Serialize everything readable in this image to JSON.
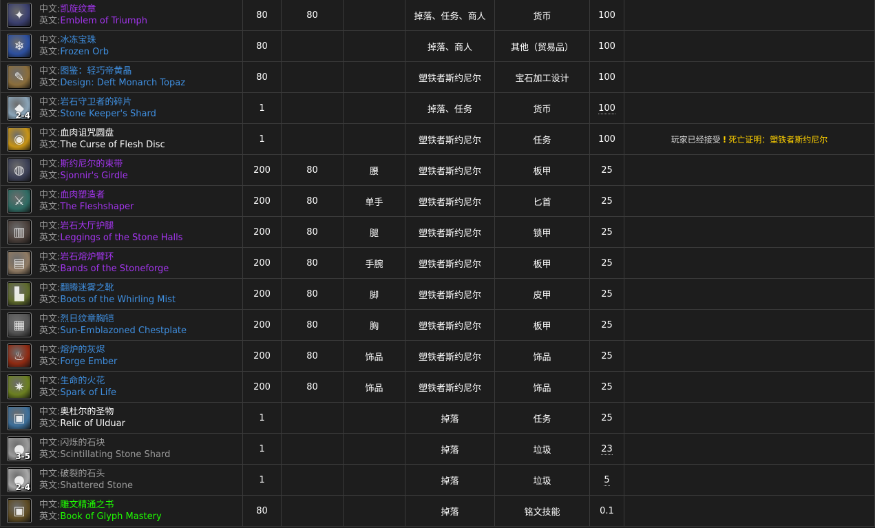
{
  "labels": {
    "zh": "中文:",
    "en": "英文:"
  },
  "rows": [
    {
      "icon": "emblem-of-triumph-icon",
      "bg": "#3a3f6e",
      "glyph": "✦",
      "zh": "凯旋纹章",
      "en": "Emblem of Triumph",
      "quality": "epic",
      "item_level": "80",
      "req_level": "80",
      "slot": "",
      "source": "掉落、任务、商人",
      "type": "货币",
      "pct": "100",
      "pct_dotted": false,
      "note_prefix": "",
      "note_quest": "",
      "stack": ""
    },
    {
      "icon": "frozen-orb-icon",
      "bg": "#2c4f9e",
      "glyph": "❄",
      "zh": "冰冻宝珠",
      "en": "Frozen Orb",
      "quality": "rare",
      "item_level": "80",
      "req_level": "",
      "slot": "",
      "source": "掉落、商人",
      "type": "其他（贸易品）",
      "pct": "100",
      "pct_dotted": false,
      "note_prefix": "",
      "note_quest": "",
      "stack": ""
    },
    {
      "icon": "design-scroll-icon",
      "bg": "#8a6d3b",
      "glyph": "✎",
      "zh": "图鉴：轻巧帝黄晶",
      "en": "Design: Deft Monarch Topaz",
      "quality": "rare",
      "item_level": "80",
      "req_level": "",
      "slot": "",
      "source": "塑铁者斯约尼尔",
      "type": "宝石加工设计",
      "pct": "100",
      "pct_dotted": false,
      "note_prefix": "",
      "note_quest": "",
      "stack": ""
    },
    {
      "icon": "stone-shard-icon",
      "bg": "#8aa4b8",
      "glyph": "◆",
      "zh": "岩石守卫者的碎片",
      "en": "Stone Keeper's Shard",
      "quality": "rare",
      "item_level": "1",
      "req_level": "",
      "slot": "",
      "source": "掉落、任务",
      "type": "货币",
      "pct": "100",
      "pct_dotted": true,
      "note_prefix": "",
      "note_quest": "",
      "stack": "2-4"
    },
    {
      "icon": "flesh-disc-icon",
      "bg": "#c79416",
      "glyph": "◉",
      "zh": "血肉诅咒圆盘",
      "en": "The Curse of Flesh Disc",
      "quality": "common",
      "item_level": "1",
      "req_level": "",
      "slot": "",
      "source": "塑铁者斯约尼尔",
      "type": "任务",
      "pct": "100",
      "pct_dotted": false,
      "note_prefix": "玩家已经接受",
      "note_quest": "死亡证明：塑铁者斯约尼尔",
      "stack": ""
    },
    {
      "icon": "girdle-icon",
      "bg": "#3b3f55",
      "glyph": "◍",
      "zh": "斯约尼尔的束带",
      "en": "Sjonnir's Girdle",
      "quality": "epic",
      "item_level": "200",
      "req_level": "80",
      "slot": "腰",
      "source": "塑铁者斯约尼尔",
      "type": "板甲",
      "pct": "25",
      "pct_dotted": false,
      "note_prefix": "",
      "note_quest": "",
      "stack": ""
    },
    {
      "icon": "dagger-icon",
      "bg": "#2f6b63",
      "glyph": "⚔",
      "zh": "血肉塑造者",
      "en": "The Fleshshaper",
      "quality": "epic",
      "item_level": "200",
      "req_level": "80",
      "slot": "单手",
      "source": "塑铁者斯约尼尔",
      "type": "匕首",
      "pct": "25",
      "pct_dotted": false,
      "note_prefix": "",
      "note_quest": "",
      "stack": ""
    },
    {
      "icon": "leggings-icon",
      "bg": "#4a3f3a",
      "glyph": "▥",
      "zh": "岩石大厅护腿",
      "en": "Leggings of the Stone Halls",
      "quality": "epic",
      "item_level": "200",
      "req_level": "80",
      "slot": "腿",
      "source": "塑铁者斯约尼尔",
      "type": "锁甲",
      "pct": "25",
      "pct_dotted": false,
      "note_prefix": "",
      "note_quest": "",
      "stack": ""
    },
    {
      "icon": "bracer-icon",
      "bg": "#8f7a63",
      "glyph": "▤",
      "zh": "岩石熔炉臂环",
      "en": "Bands of the Stoneforge",
      "quality": "epic",
      "item_level": "200",
      "req_level": "80",
      "slot": "手腕",
      "source": "塑铁者斯约尼尔",
      "type": "板甲",
      "pct": "25",
      "pct_dotted": false,
      "note_prefix": "",
      "note_quest": "",
      "stack": ""
    },
    {
      "icon": "boots-icon",
      "bg": "#5e6a2c",
      "glyph": "▙",
      "zh": "翻腾迷雾之靴",
      "en": "Boots of the Whirling Mist",
      "quality": "rare",
      "item_level": "200",
      "req_level": "80",
      "slot": "脚",
      "source": "塑铁者斯约尼尔",
      "type": "皮甲",
      "pct": "25",
      "pct_dotted": false,
      "note_prefix": "",
      "note_quest": "",
      "stack": ""
    },
    {
      "icon": "chestplate-icon",
      "bg": "#555555",
      "glyph": "▦",
      "zh": "烈日纹章胸铠",
      "en": "Sun-Emblazoned Chestplate",
      "quality": "rare",
      "item_level": "200",
      "req_level": "80",
      "slot": "胸",
      "source": "塑铁者斯约尼尔",
      "type": "板甲",
      "pct": "25",
      "pct_dotted": false,
      "note_prefix": "",
      "note_quest": "",
      "stack": ""
    },
    {
      "icon": "ember-icon",
      "bg": "#8e2a12",
      "glyph": "♨",
      "zh": "熔炉的灰烬",
      "en": "Forge Ember",
      "quality": "rare",
      "item_level": "200",
      "req_level": "80",
      "slot": "饰品",
      "source": "塑铁者斯约尼尔",
      "type": "饰品",
      "pct": "25",
      "pct_dotted": false,
      "note_prefix": "",
      "note_quest": "",
      "stack": ""
    },
    {
      "icon": "spark-icon",
      "bg": "#6b7f20",
      "glyph": "✷",
      "zh": "生命的火花",
      "en": "Spark of Life",
      "quality": "rare",
      "item_level": "200",
      "req_level": "80",
      "slot": "饰品",
      "source": "塑铁者斯约尼尔",
      "type": "饰品",
      "pct": "25",
      "pct_dotted": false,
      "note_prefix": "",
      "note_quest": "",
      "stack": ""
    },
    {
      "icon": "relic-book-icon",
      "bg": "#3d6f9a",
      "glyph": "▣",
      "zh": "奥杜尔的圣物",
      "en": "Relic of Ulduar",
      "quality": "common",
      "item_level": "1",
      "req_level": "",
      "slot": "",
      "source": "掉落",
      "type": "任务",
      "pct": "25",
      "pct_dotted": false,
      "note_prefix": "",
      "note_quest": "",
      "stack": ""
    },
    {
      "icon": "stone-icon",
      "bg": "#9a9a9a",
      "glyph": "●",
      "zh": "闪烁的石块",
      "en": "Scintillating Stone Shard",
      "quality": "poor",
      "item_level": "1",
      "req_level": "",
      "slot": "",
      "source": "掉落",
      "type": "垃圾",
      "pct": "23",
      "pct_dotted": true,
      "note_prefix": "",
      "note_quest": "",
      "stack": "3-5"
    },
    {
      "icon": "stone-icon",
      "bg": "#a8a8a8",
      "glyph": "●",
      "zh": "破裂的石头",
      "en": "Shattered Stone",
      "quality": "poor",
      "item_level": "1",
      "req_level": "",
      "slot": "",
      "source": "掉落",
      "type": "垃圾",
      "pct": "5",
      "pct_dotted": true,
      "note_prefix": "",
      "note_quest": "",
      "stack": "2-4"
    },
    {
      "icon": "glyph-book-icon",
      "bg": "#5d4b23",
      "glyph": "▣",
      "zh": "雕文精通之书",
      "en": "Book of Glyph Mastery",
      "quality": "uncommon",
      "item_level": "80",
      "req_level": "",
      "slot": "",
      "source": "掉落",
      "type": "铭文技能",
      "pct": "0.1",
      "pct_dotted": false,
      "note_prefix": "",
      "note_quest": "",
      "stack": ""
    }
  ]
}
